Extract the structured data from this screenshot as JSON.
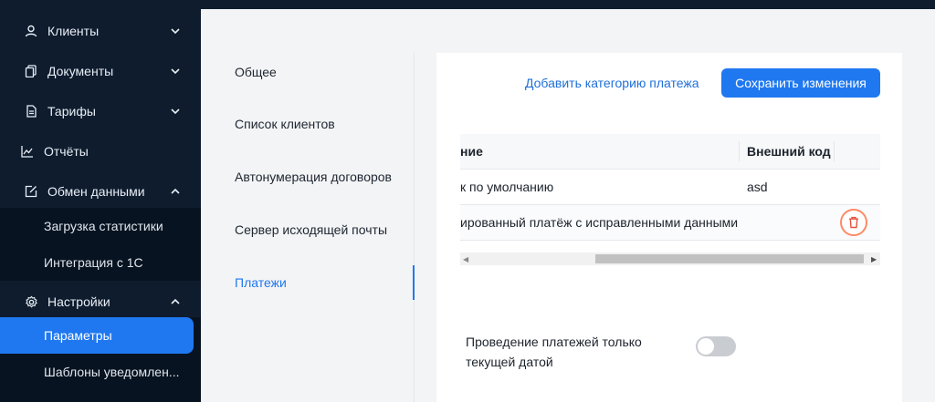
{
  "sidebar": {
    "items": [
      {
        "label": "Клиенты",
        "icon": "user-icon",
        "expanded": false
      },
      {
        "label": "Документы",
        "icon": "documents-icon",
        "expanded": false
      },
      {
        "label": "Тарифы",
        "icon": "tariff-icon",
        "expanded": false
      },
      {
        "label": "Отчёты",
        "icon": "chart-line-icon"
      },
      {
        "label": "Обмен данными",
        "icon": "data-exchange-icon",
        "expanded": true
      }
    ],
    "exchange_sub": [
      "Загрузка статистики",
      "Интеграция с 1С"
    ],
    "settings": {
      "label": "Настройки",
      "icon": "gear-icon",
      "expanded": true
    },
    "settings_sub": [
      "Параметры",
      "Шаблоны уведомлен..."
    ]
  },
  "settings_menu": {
    "items": [
      "Общее",
      "Список клиентов",
      "Автонумерация договоров",
      "Сервер исходящей почты",
      "Платежи"
    ],
    "active": "Платежи"
  },
  "payments": {
    "add_category_link": "Добавить категорию платежа",
    "save_button": "Сохранить изменения",
    "table": {
      "headers": [
        "ние",
        "Внешний код"
      ],
      "rows": [
        {
          "name": "к по умолчанию",
          "code": "asd"
        },
        {
          "name": "ированный платёж с исправленными данными",
          "code": ""
        }
      ]
    },
    "toggle_label": "Проведение платежей только текущей датой",
    "toggle_on": false
  },
  "colors": {
    "accent": "#1f78f0",
    "sidebar_bg": "#0e1c2e",
    "delete_ring": "#ff8a66"
  }
}
